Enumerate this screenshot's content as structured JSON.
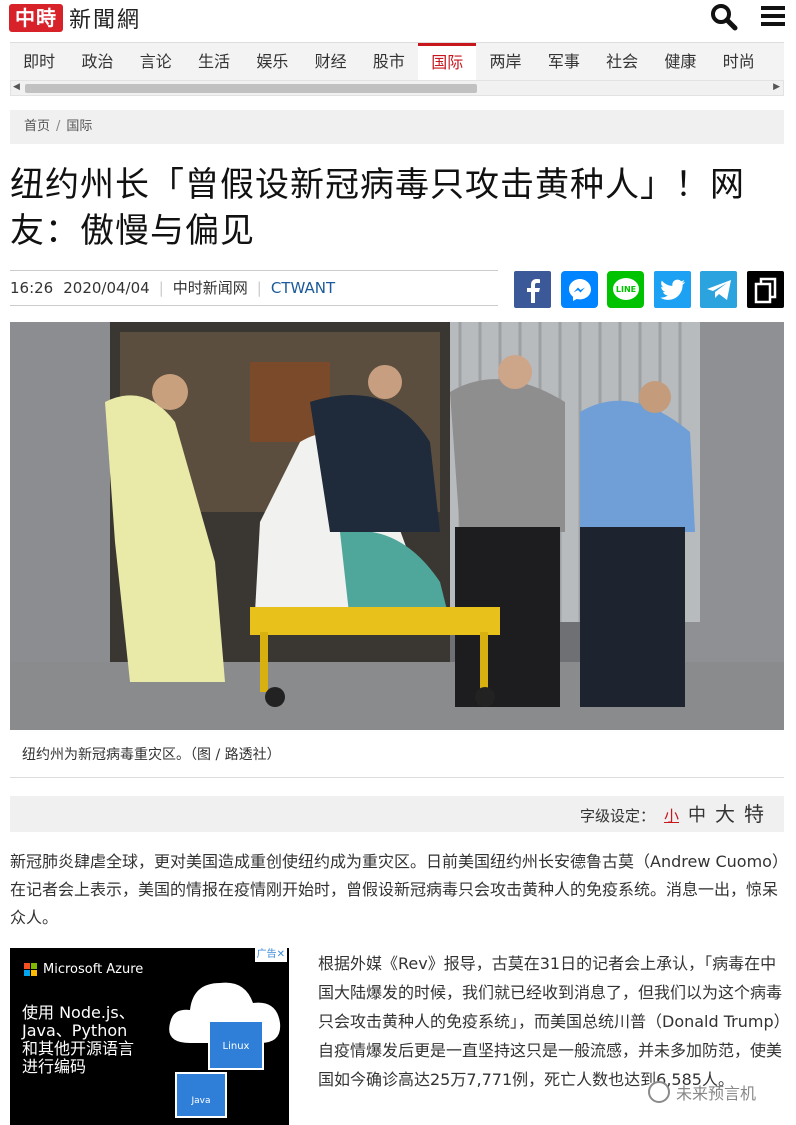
{
  "header": {
    "logo_badge": "中時",
    "logo_text": "新聞網"
  },
  "nav": {
    "items": [
      "即时",
      "政治",
      "言论",
      "生活",
      "娱乐",
      "财经",
      "股市",
      "国际",
      "两岸",
      "军事",
      "社会",
      "健康",
      "时尚"
    ],
    "active": "国际"
  },
  "breadcrumb": {
    "home": "首页",
    "separator": "/",
    "section": "国际"
  },
  "article": {
    "title": "纽约州长「曾假设新冠病毒只攻击黄种人」！网友：傲慢与偏见",
    "time": "16:26",
    "date": "2020/04/04",
    "source": "中时新闻网",
    "author": "CTWANT",
    "caption": "纽约州为新冠病毒重灾区。（图 / 路透社）",
    "paragraph1": "新冠肺炎肆虐全球，更对美国造成重创使纽约成为重灾区。日前美国纽约州长安德鲁古莫（Andrew Cuomo）在记者会上表示，美国的情报在疫情刚开始时，曾假设新冠病毒只会攻击黄种人的免疫系统。消息一出，惊呆众人。",
    "paragraph2": "根据外媒《Rev》报导，古莫在31日的记者会上承认，「病毒在中国大陆爆发的时候，我们就已经收到消息了，但我们以为这个病毒只会攻击黄种人的免疫系统」，而美国总统川普（Donald Trump）自疫情爆发后更是一直坚持这只是一般流感，并未多加防范，使美国如今确诊高达25万7,771例，死亡人数也达到6,585人。"
  },
  "share": {
    "icons": [
      "facebook-icon",
      "messenger-icon",
      "line-icon",
      "twitter-icon",
      "telegram-icon",
      "copy-link-icon"
    ],
    "colors": [
      "#3b5998",
      "#0084ff",
      "#00c300",
      "#1da1f2",
      "#2aa3df",
      "#000000"
    ],
    "line_label": "LINE"
  },
  "fontbar": {
    "label": "字级设定：",
    "options": [
      "小",
      "中",
      "大",
      "特"
    ],
    "selected": "小"
  },
  "ad": {
    "close_label": "广告✕",
    "brand": "Microsoft Azure",
    "text": "使用 Node.js、Java、Python 和其他开源语言进行编码",
    "linux_label": "Linux",
    "java_label": "Java",
    "ms_colors": [
      "#f25022",
      "#7fba00",
      "#00a4ef",
      "#ffb900"
    ]
  },
  "watermark": {
    "text": "未来预言机"
  }
}
